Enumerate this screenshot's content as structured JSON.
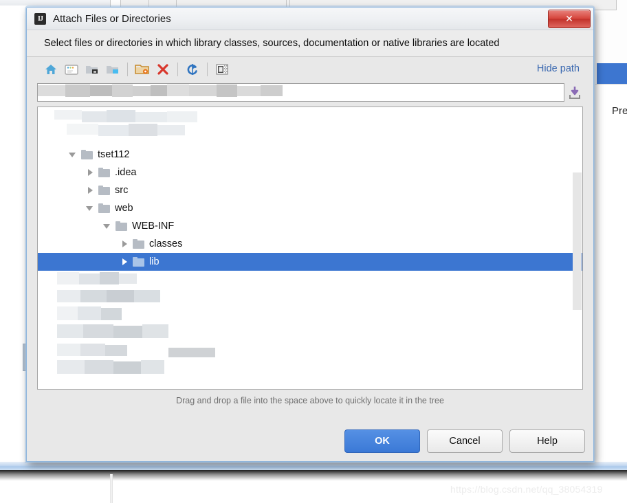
{
  "dialog": {
    "title": "Attach Files or Directories",
    "app_icon": "intellij-idea-icon",
    "close_label": "✕",
    "subtitle": "Select files or directories in which library classes, sources, documentation or native libraries are located",
    "hide_path_label": "Hide path",
    "hint": "Drag and drop a file into the space above to quickly locate it in the tree",
    "path_value": ""
  },
  "toolbar": {
    "items": [
      {
        "name": "home-icon",
        "tooltip": "Home"
      },
      {
        "name": "desktop-icon",
        "tooltip": "Desktop"
      },
      {
        "name": "project-folder-icon",
        "tooltip": "Project"
      },
      {
        "name": "module-folder-icon",
        "tooltip": "Module"
      },
      {
        "name": "new-folder-icon",
        "tooltip": "New Folder"
      },
      {
        "name": "delete-icon",
        "tooltip": "Delete"
      },
      {
        "name": "refresh-icon",
        "tooltip": "Refresh"
      },
      {
        "name": "show-hidden-icon",
        "tooltip": "Show Hidden Files"
      }
    ]
  },
  "tree": {
    "rows": [
      {
        "label": "tset112",
        "indent": 1,
        "twisty": "open",
        "selected": false
      },
      {
        "label": ".idea",
        "indent": 2,
        "twisty": "closed",
        "selected": false
      },
      {
        "label": "src",
        "indent": 2,
        "twisty": "closed",
        "selected": false
      },
      {
        "label": "web",
        "indent": 2,
        "twisty": "open",
        "selected": false
      },
      {
        "label": "WEB-INF",
        "indent": 3,
        "twisty": "open",
        "selected": false
      },
      {
        "label": "classes",
        "indent": 4,
        "twisty": "closed",
        "selected": false
      },
      {
        "label": "lib",
        "indent": 4,
        "twisty": "closed",
        "selected": true
      }
    ]
  },
  "buttons": {
    "ok": "OK",
    "cancel": "Cancel",
    "help": "Help"
  },
  "background": {
    "partial_text": "Pre",
    "watermark": "https://blog.csdn.net/qq_38054319"
  },
  "colors": {
    "selection": "#3c76d1",
    "primary_button": "#3b79d6",
    "link": "#3a68b0",
    "close_button": "#d6453c",
    "dialog_bg": "#e8e8e8"
  }
}
